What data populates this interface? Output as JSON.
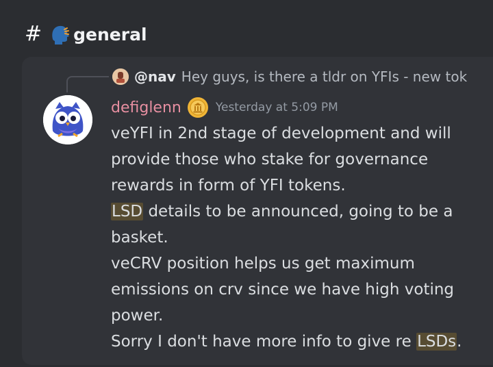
{
  "channel": {
    "hash_symbol": "#",
    "emoji_icon": "speaking-head-icon",
    "name": "general"
  },
  "reply": {
    "avatar_icon": "user-avatar-small",
    "mention": "@nav",
    "text": "Hey guys, is there a tldr on YFIs - new tok"
  },
  "message": {
    "avatar_icon": "owl-avatar",
    "author": "defiglenn",
    "badge_icon": "coin-badge-icon",
    "timestamp": "Yesterday at 5:09 PM",
    "lines": [
      "veYFI in 2nd stage of development and will",
      "provide those who stake for governance",
      "rewards in form of YFI tokens.",
      "details to be announced, going to be a",
      "basket.",
      "veCRV position helps us get maximum",
      "emissions on crv since we have high voting",
      "power.",
      "Sorry I don't have more info to give re "
    ],
    "highlight_lsd": "LSD",
    "highlight_lsds": "LSDs",
    "final_period": "."
  },
  "colors": {
    "background": "#2b2d31",
    "card": "#313338",
    "author": "#e78fa1",
    "highlight": "#574c32"
  }
}
